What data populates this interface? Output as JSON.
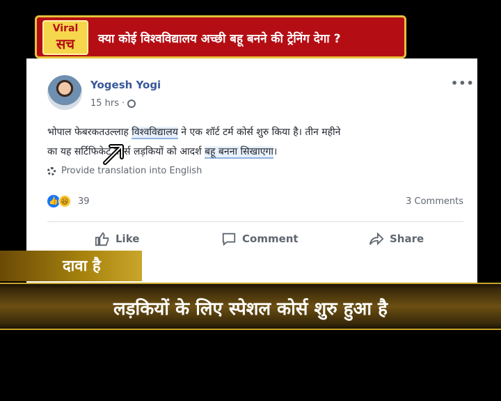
{
  "banner": {
    "logo_line1": "Viral",
    "logo_line2": "सच",
    "title": "क्या कोई विश्वविद्यालय अच्छी बहू बनने की ट्रेनिंग देगा ?"
  },
  "post": {
    "author": "Yogesh Yogi",
    "time": "15 hrs ·",
    "text_line1_a": "भोपाल फेबरकतउल्लाह ",
    "text_line1_hl": "विश्वविद्यालय",
    "text_line1_b": " ने एक शॉर्ट टर्म कोर्स शुरु किया है। तीन महीने",
    "text_line2_a": "का यह सर्टिफिकेट कोर्स लड़कियों को आदर्श ",
    "text_line2_hl": "बहू बनना सिखाएगा",
    "text_line2_b": "।",
    "translate_label": "Provide translation into English",
    "reaction_count": "39",
    "comments_count": "3 Comments",
    "actions": {
      "like": "Like",
      "comment": "Comment",
      "share": "Share"
    }
  },
  "overlay": {
    "claim_label": "दावा है",
    "caption": "लड़कियों के लिए स्पेशल कोर्स शुरु हुआ है"
  }
}
